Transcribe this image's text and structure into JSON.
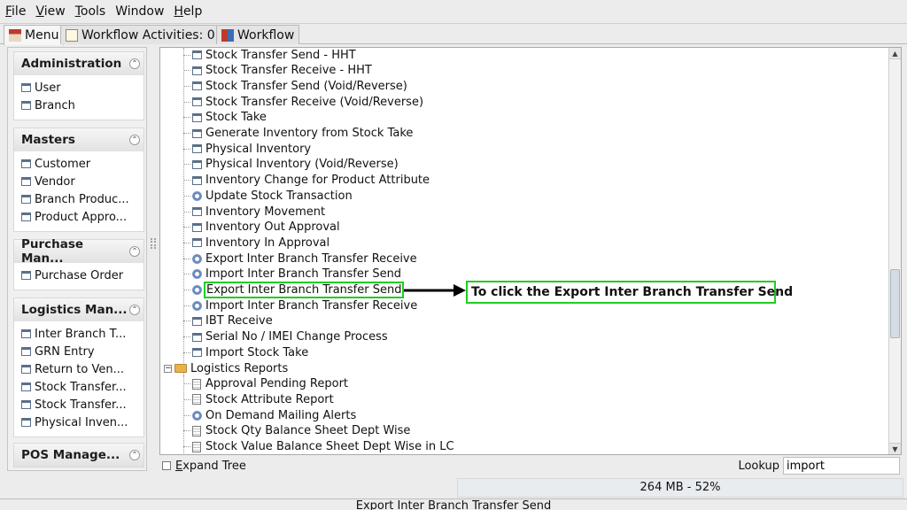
{
  "menu": [
    {
      "pre": "",
      "u": "F",
      "post": "ile"
    },
    {
      "pre": "",
      "u": "V",
      "post": "iew"
    },
    {
      "pre": "",
      "u": "T",
      "post": "ools"
    },
    {
      "pre": "Window",
      "u": "",
      "post": ""
    },
    {
      "pre": "",
      "u": "H",
      "post": "elp"
    }
  ],
  "tabs": [
    {
      "label": "Menu",
      "icon": "home-icon"
    },
    {
      "label": "Workflow Activities: 0",
      "icon": "calendar-icon"
    },
    {
      "label": "Workflow",
      "icon": "workflow-icon"
    }
  ],
  "sidebar": {
    "sections": [
      {
        "title": "Administration",
        "items": [
          "User",
          "Branch"
        ]
      },
      {
        "title": "Masters",
        "items": [
          "Customer",
          "Vendor",
          "Branch Produc...",
          "Product Appro..."
        ]
      },
      {
        "title": "Purchase Man...",
        "items": [
          "Purchase Order"
        ]
      },
      {
        "title": "Logistics Man...",
        "items": [
          "Inter Branch T...",
          "GRN Entry",
          "Return to Ven...",
          "Stock Transfer...",
          "Stock Transfer...",
          "Physical Inven..."
        ]
      },
      {
        "title": "POS Manage...",
        "items": []
      }
    ]
  },
  "tree": {
    "rows": [
      {
        "label": "Stock Transfer Send - HHT",
        "icon": "window",
        "level": 2
      },
      {
        "label": "Stock Transfer Receive - HHT",
        "icon": "window",
        "level": 2
      },
      {
        "label": "Stock Transfer Send (Void/Reverse)",
        "icon": "window",
        "level": 2
      },
      {
        "label": "Stock Transfer Receive (Void/Reverse)",
        "icon": "window",
        "level": 2
      },
      {
        "label": "Stock Take",
        "icon": "window",
        "level": 2
      },
      {
        "label": "Generate Inventory from Stock Take",
        "icon": "window",
        "level": 2
      },
      {
        "label": "Physical Inventory",
        "icon": "window",
        "level": 2
      },
      {
        "label": "Physical Inventory (Void/Reverse)",
        "icon": "window",
        "level": 2
      },
      {
        "label": "Inventory Change for Product Attribute",
        "icon": "window",
        "level": 2
      },
      {
        "label": "Update Stock Transaction",
        "icon": "process",
        "level": 2
      },
      {
        "label": "Inventory Movement",
        "icon": "window",
        "level": 2
      },
      {
        "label": "Inventory Out Approval",
        "icon": "window",
        "level": 2
      },
      {
        "label": "Inventory In Approval",
        "icon": "window",
        "level": 2
      },
      {
        "label": "Export Inter Branch Transfer Receive",
        "icon": "process",
        "level": 2
      },
      {
        "label": "Import Inter Branch Transfer Send",
        "icon": "process",
        "level": 2
      },
      {
        "label": "Export Inter Branch Transfer Send",
        "icon": "process",
        "level": 2,
        "highlight": true
      },
      {
        "label": "Import Inter Branch Transfer Receive",
        "icon": "process",
        "level": 2
      },
      {
        "label": "IBT Receive",
        "icon": "window",
        "level": 2
      },
      {
        "label": "Serial No / IMEI Change Process",
        "icon": "window",
        "level": 2
      },
      {
        "label": "Import Stock Take",
        "icon": "window",
        "level": 2
      },
      {
        "label": "Logistics Reports",
        "icon": "folder",
        "level": 1
      },
      {
        "label": "Approval Pending Report",
        "icon": "report",
        "level": 2
      },
      {
        "label": "Stock Attribute Report",
        "icon": "report",
        "level": 2
      },
      {
        "label": "On Demand Mailing Alerts",
        "icon": "process",
        "level": 2
      },
      {
        "label": "Stock Qty Balance Sheet Dept Wise",
        "icon": "report",
        "level": 2
      },
      {
        "label": "Stock Value Balance Sheet Dept Wise in LC",
        "icon": "report",
        "level": 2
      }
    ]
  },
  "bottom": {
    "expand_label_u": "E",
    "expand_label_rest": "xpand Tree",
    "lookup_label": "Lookup",
    "lookup_value": "import"
  },
  "memory": {
    "text": "264 MB - 52%",
    "fraction": 0.52
  },
  "status": {
    "text": "Export Inter Branch Transfer Send"
  },
  "annotation": {
    "text": "To click the Export Inter Branch Transfer Send"
  },
  "colors": {
    "highlight": "#22cc22"
  }
}
